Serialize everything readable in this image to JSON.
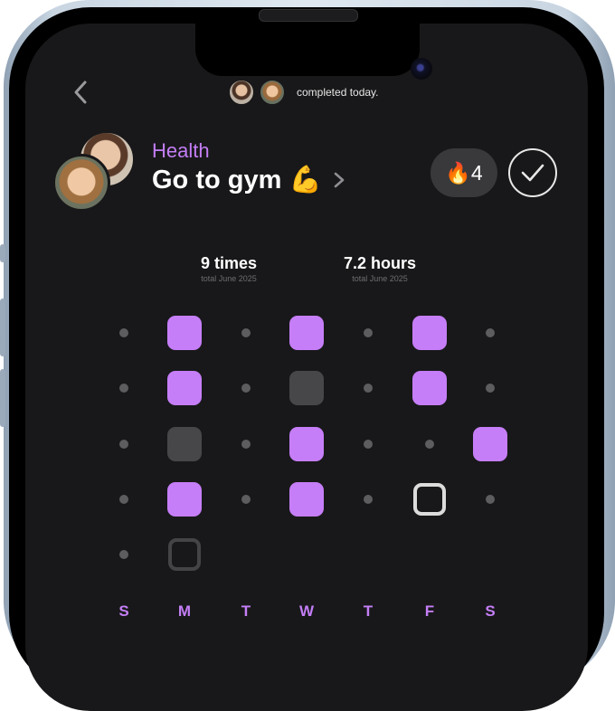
{
  "header": {
    "completed_text": "completed today."
  },
  "habit": {
    "category": "Health",
    "title": "Go to gym 💪",
    "streak_icon": "🔥",
    "streak_count": "4"
  },
  "stats": [
    {
      "value": "9 times",
      "sub": "total June 2025"
    },
    {
      "value": "7.2 hours",
      "sub": "total June 2025"
    }
  ],
  "calendar": {
    "weekdays": [
      "S",
      "M",
      "T",
      "W",
      "T",
      "F",
      "S"
    ],
    "rows": [
      [
        "empty",
        "done",
        "empty",
        "done",
        "empty",
        "done",
        "empty"
      ],
      [
        "empty",
        "done",
        "empty",
        "missed",
        "empty",
        "done",
        "empty"
      ],
      [
        "empty",
        "missed",
        "empty",
        "done",
        "empty",
        "empty",
        "done"
      ],
      [
        "empty",
        "done",
        "empty",
        "done",
        "empty",
        "today",
        "empty"
      ],
      [
        "empty",
        "future"
      ]
    ]
  },
  "colors": {
    "accent": "#c67ef8",
    "background": "#18181a",
    "missed": "#47474a"
  }
}
